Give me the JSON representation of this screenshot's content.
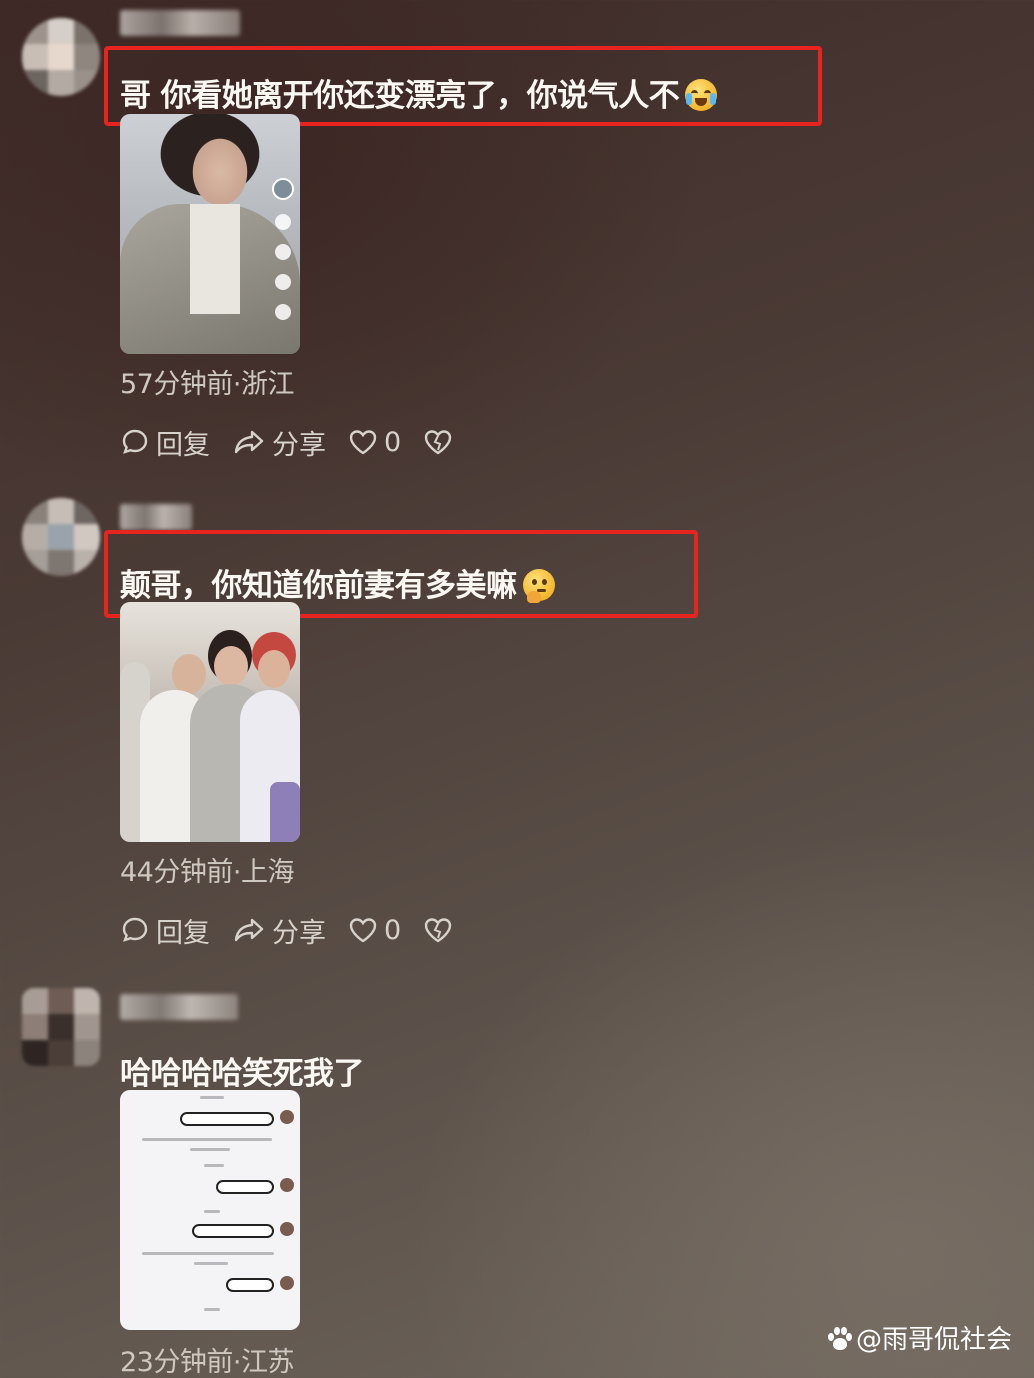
{
  "comments": [
    {
      "text": "哥 你看她离开你还变漂亮了，你说气人不",
      "emoji": "crying-laughing-emoji",
      "highlighted": true,
      "meta": "57分钟前·浙江",
      "actions": {
        "reply": "回复",
        "share": "分享",
        "like_count": "0"
      }
    },
    {
      "text": "颠哥，你知道你前妻有多美嘛",
      "emoji": "thinking-emoji",
      "highlighted": true,
      "meta": "44分钟前·上海",
      "actions": {
        "reply": "回复",
        "share": "分享",
        "like_count": "0"
      }
    },
    {
      "text": "哈哈哈哈笑死我了",
      "emoji": "",
      "highlighted": false,
      "meta": "23分钟前·江苏"
    }
  ],
  "watermark": "@雨哥侃社会",
  "colors": {
    "highlight_box": "#e8241f",
    "background_top": "#3e2a27",
    "background_bottom": "#6e665d"
  }
}
